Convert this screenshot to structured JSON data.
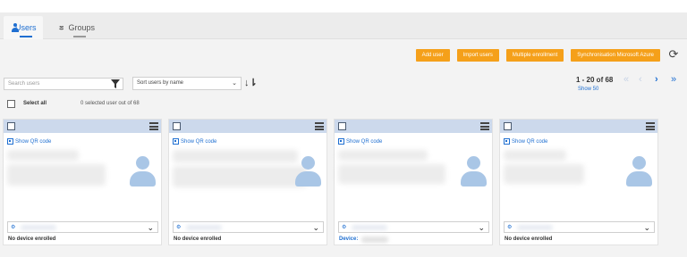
{
  "tabs": [
    {
      "label": "Users",
      "active": true
    },
    {
      "label": "Groups",
      "active": false
    }
  ],
  "actions": {
    "add_user": "Add user",
    "import_users": "Import users",
    "multiple_enrollment": "Multiple enrollment",
    "sync_azure": "Synchronisation Microsoft Azure"
  },
  "toolbar": {
    "search_placeholder": "Search users",
    "sort_value": "Sort users by name",
    "icons": {
      "filter": "filter-icon",
      "sort_order": "sort-alpha-icon",
      "refresh": "refresh-icon"
    }
  },
  "pagination": {
    "range": "1 - 20 of 68",
    "show": "Show 50"
  },
  "selection": {
    "select_all": "Select all",
    "count_text": "0 selected user out of 68"
  },
  "cards": [
    {
      "qr_label": "Show QR code",
      "device_text": "No device enrolled",
      "device_link": false
    },
    {
      "qr_label": "Show QR code",
      "device_text": "No device enrolled",
      "device_link": false
    },
    {
      "qr_label": "Show QR code",
      "device_text": "Device:",
      "device_link": true
    },
    {
      "qr_label": "Show QR code",
      "device_text": "No device enrolled",
      "device_link": false
    }
  ],
  "colors": {
    "accent": "#1f6fd1",
    "action": "#f5a01a",
    "card_header": "#ccd9ec",
    "avatar": "#a9c6e6"
  }
}
